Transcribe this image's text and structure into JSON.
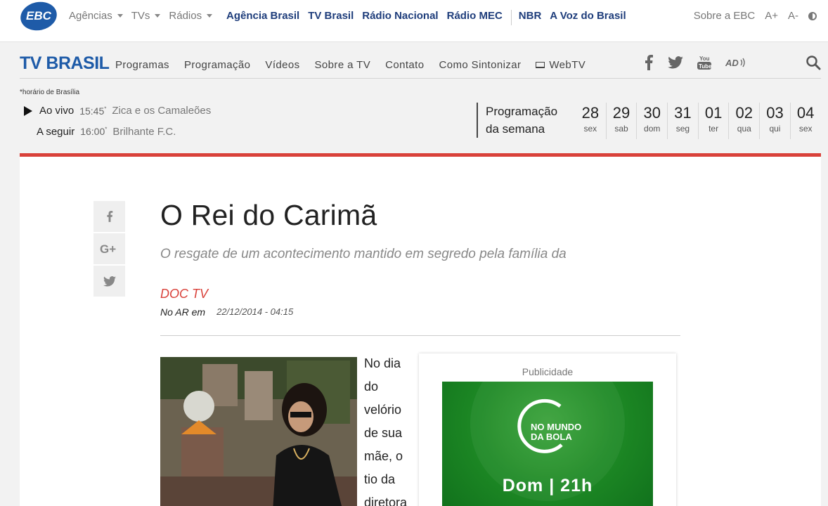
{
  "ebc": {
    "logo_text": "EBC",
    "menu": [
      {
        "label": "Agências"
      },
      {
        "label": "TVs"
      },
      {
        "label": "Rádios"
      }
    ],
    "links": [
      "Agência Brasil",
      "TV Brasil",
      "Rádio Nacional",
      "Rádio MEC",
      "NBR",
      "A Voz do Brasil"
    ],
    "right": {
      "about": "Sobre a EBC",
      "font_up": "A+",
      "font_down": "A-"
    }
  },
  "tv_nav": {
    "logo": "TV BRASIL",
    "menu": [
      "Programas",
      "Programação",
      "Vídeos",
      "Sobre a TV",
      "Contato",
      "Como Sintonizar",
      "WebTV"
    ],
    "social_icons": [
      "facebook-icon",
      "twitter-icon",
      "youtube-icon",
      "audio-description-icon"
    ]
  },
  "schedule": {
    "tz_note": "*horário de Brasília",
    "live": {
      "label": "Ao vivo",
      "time": "15:45",
      "show": "Zica e os Camaleões"
    },
    "next": {
      "label": "A seguir",
      "time": "16:00",
      "show": "Brilhante F.C."
    },
    "week_title_1": "Programação",
    "week_title_2": "da semana",
    "days": [
      {
        "num": "28",
        "wd": "sex"
      },
      {
        "num": "29",
        "wd": "sab"
      },
      {
        "num": "30",
        "wd": "dom"
      },
      {
        "num": "31",
        "wd": "seg"
      },
      {
        "num": "01",
        "wd": "ter"
      },
      {
        "num": "02",
        "wd": "qua"
      },
      {
        "num": "03",
        "wd": "qui"
      },
      {
        "num": "04",
        "wd": "sex"
      }
    ]
  },
  "article": {
    "title": "O Rei do Carimã",
    "subtitle": "O resgate de um acontecimento mantido em segredo pela família da",
    "category": "DOC TV",
    "air_label": "No AR em",
    "air_date": "22/12/2014 - 04:15",
    "body_words": [
      "No dia",
      "do",
      "velório",
      "de sua",
      "mãe, o",
      "tio da",
      "diretora"
    ]
  },
  "ad": {
    "label": "Publicidade",
    "title_line1": "NO MUNDO",
    "title_line2": "DA BOLA",
    "time": "Dom | 21h"
  },
  "colors": {
    "brand_blue": "#1e5ba8",
    "accent_red": "#d9413a",
    "link_navy": "#1e3d7b"
  }
}
